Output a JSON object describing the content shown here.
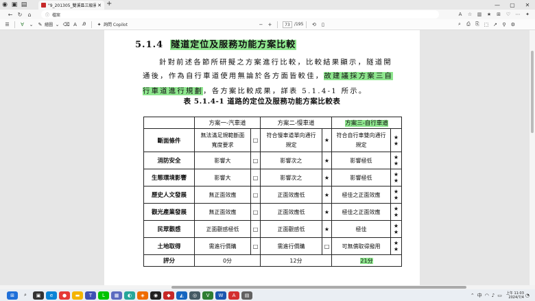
{
  "browser": {
    "tab_title": "\"9_201305_雙溪區三級景與附…",
    "tab_close": "✕",
    "new_tab": "+",
    "url_text": "檔案",
    "win_min": "—",
    "win_max": "▢",
    "win_close": "✕"
  },
  "pdf_toolbar": {
    "draw_label": "繪圖",
    "copilot_label": "詢問 Copilot",
    "page_current": "73",
    "page_total": "/195"
  },
  "document": {
    "section_number": "5.1.4",
    "section_title": "隧道定位及服務功能方案比較",
    "para_line1": "針對前述各節所研擬之方案進行比較，比較結果顯示，隧道開",
    "para_line2_normal": "通後，作為自行車道使用無論於各方面皆較佳，",
    "para_line2_highlight": "故建議採方案三自",
    "para_line3_highlight": "行車道進行規劃",
    "para_line3_normal": "，各方案比較成果，詳表 5.1.4-1 所示。",
    "table_caption": "表 5.1.4-1 道路的定位及服務功能方案比較表"
  },
  "table": {
    "headers": [
      "方案一-汽車道",
      "方案二-慢車道",
      "方案三-自行車道"
    ],
    "rows": [
      {
        "criterion": "斷面條件",
        "o1": "無法滿足規範斷面寬度要求",
        "m1": "□",
        "o2": "符合慢車道單向通行規定",
        "m2": "★",
        "o3": "符合自行車雙向通行規定",
        "m3": "★★"
      },
      {
        "criterion": "消防安全",
        "o1": "影響大",
        "m1": "□",
        "o2": "影響次之",
        "m2": "★",
        "o3": "影響極低",
        "m3": "★★"
      },
      {
        "criterion": "生態環境影響",
        "o1": "影響大",
        "m1": "□",
        "o2": "影響次之",
        "m2": "★",
        "o3": "影響極低",
        "m3": "★★"
      },
      {
        "criterion": "歷史人文發展",
        "o1": "無正面效應",
        "m1": "□",
        "o2": "正面效應低",
        "m2": "★",
        "o3": "極佳之正面效應",
        "m3": "★★"
      },
      {
        "criterion": "觀光產業發展",
        "o1": "無正面效應",
        "m1": "□",
        "o2": "正面效應低",
        "m2": "★",
        "o3": "極佳之正面效應",
        "m3": "★★"
      },
      {
        "criterion": "民眾觀感",
        "o1": "正面觀感極低",
        "m1": "□",
        "o2": "正面觀感低",
        "m2": "★",
        "o3": "極佳",
        "m3": "★★"
      },
      {
        "criterion": "土地取得",
        "o1": "需進行價購",
        "m1": "□",
        "o2": "需進行價購",
        "m2": "□",
        "o3": "可無償取得撥用",
        "m3": "★★"
      }
    ],
    "score_label": "評分",
    "scores": [
      "0分",
      "12分",
      "21分"
    ]
  },
  "taskbar": {
    "clock_time": "上午 11:03",
    "clock_date": "2024/7/4"
  }
}
